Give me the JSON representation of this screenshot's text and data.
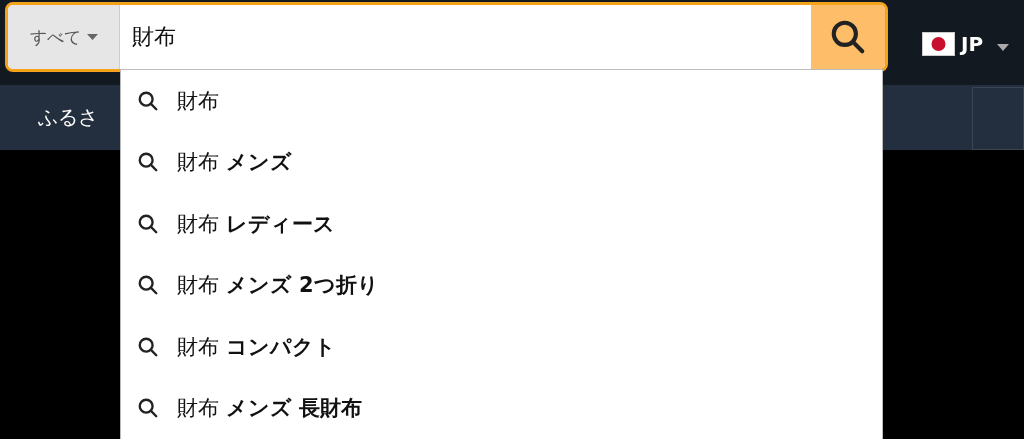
{
  "search": {
    "category": "すべて",
    "value": "財布"
  },
  "locale": {
    "label": "JP"
  },
  "nav": {
    "items": [
      "ふるさ"
    ]
  },
  "suggestions": [
    {
      "text": "財布"
    },
    {
      "text": "財布 **メンズ**"
    },
    {
      "text": "財布 **レディース**"
    },
    {
      "text": "財布 **メンズ 2つ折り**"
    },
    {
      "text": "財布 **コンパクト**"
    },
    {
      "text": "財布 **メンズ 長財布**"
    }
  ]
}
